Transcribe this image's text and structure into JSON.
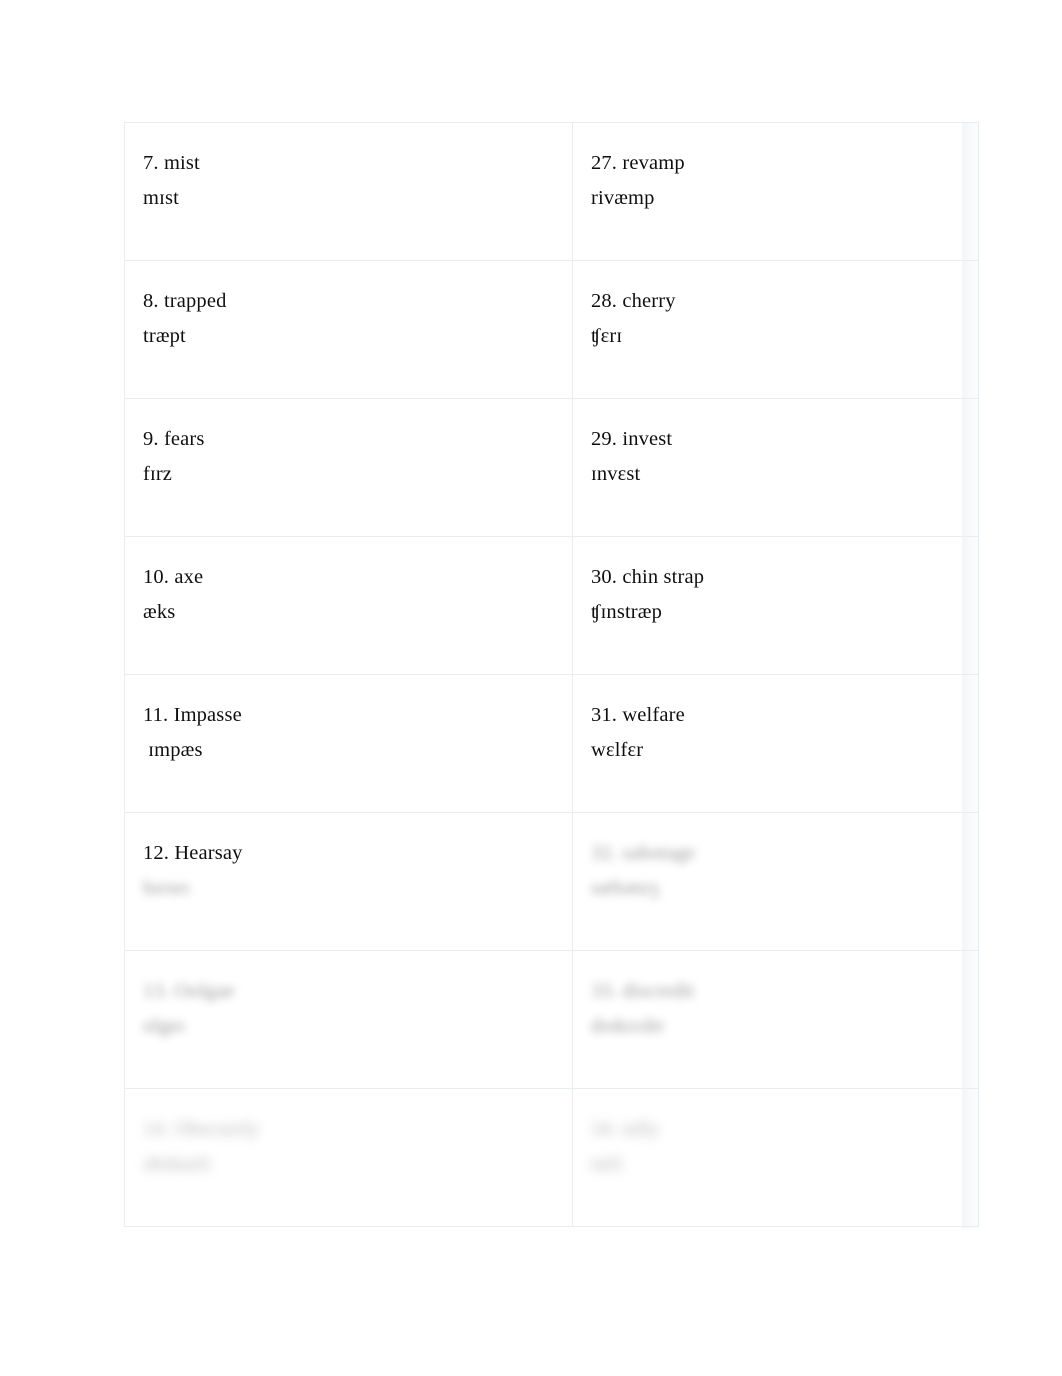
{
  "document": {
    "type": "phonetic-transcription-worksheet",
    "columns": 2,
    "rows": 8
  },
  "colors": {
    "page_background": "#ffffff",
    "cell_background": "#ffffff",
    "cell_border": "#e8eef0",
    "text": "#0f0f0f",
    "obscured_text": "#5a5a5a"
  },
  "entries": {
    "left": [
      {
        "word": "7. mist",
        "ipa": "mɪst",
        "state": "visible"
      },
      {
        "word": "8. trapped",
        "ipa": "træpt",
        "state": "visible"
      },
      {
        "word": "9. fears",
        "ipa": "fɪrz",
        "state": "visible"
      },
      {
        "word": "10. axe",
        "ipa": "æks",
        "state": "visible"
      },
      {
        "word": "11. Impasse",
        "ipa": " ɪmpæs",
        "state": "visible"
      },
      {
        "word": "12. Hearsay",
        "ipa": "hɪrseɪ",
        "state": "ipa-obscured"
      },
      {
        "word": "13. Oolgae",
        "ipa": "olgeɪ",
        "state": "obscured"
      },
      {
        "word": "14. Obscurely",
        "ipa": "əbskurli",
        "state": "obscured"
      }
    ],
    "right": [
      {
        "word": "27. revamp",
        "ipa": "rivæmp",
        "state": "visible"
      },
      {
        "word": "28. cherry",
        "ipa": "ʧɛrɪ",
        "state": "visible"
      },
      {
        "word": "29. invest",
        "ipa": "ɪnvɛst",
        "state": "visible"
      },
      {
        "word": "30. chin strap",
        "ipa": "ʧɪnstræp",
        "state": "visible"
      },
      {
        "word": "31. welfare",
        "ipa": "wɛlfɛr",
        "state": "visible"
      },
      {
        "word": "32. sabotage",
        "ipa": "sæbətɑʒ",
        "state": "obscured"
      },
      {
        "word": "33. discredit",
        "ipa": "dɪskrɛdɪt",
        "state": "obscured"
      },
      {
        "word": "34. tally",
        "ipa": "tæli",
        "state": "obscured"
      }
    ]
  }
}
